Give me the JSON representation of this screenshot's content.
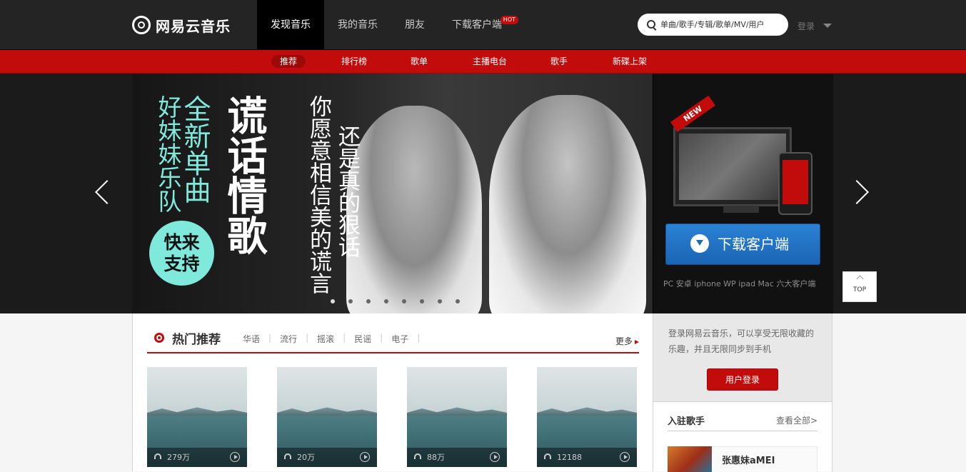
{
  "brand": {
    "name": "网易云音乐"
  },
  "topnav": [
    {
      "label": "发现音乐"
    },
    {
      "label": "我的音乐"
    },
    {
      "label": "朋友"
    },
    {
      "label": "下载客户端",
      "badge": "HOT"
    }
  ],
  "search": {
    "placeholder": "单曲/歌手/专辑/歌单/MV/用户"
  },
  "login": {
    "label": "登录"
  },
  "subnav": [
    "推荐",
    "排行榜",
    "歌单",
    "主播电台",
    "歌手",
    "新碟上架"
  ],
  "banner": {
    "line1": "好妹妹乐队",
    "line2": "全新单曲",
    "badge_line1": "快来",
    "badge_line2": "支持",
    "title": "谎话情歌",
    "tag_line1": "你愿意相信美的谎言",
    "tag_line2": "还是真的狠话",
    "dots_total": 8,
    "dots_active": 0
  },
  "download": {
    "new_tag": "NEW",
    "button_label": "下载客户端",
    "platforms": "PC 安卓 iphone WP ipad Mac 六大客户端"
  },
  "top_button": {
    "label": "TOP"
  },
  "hot": {
    "title": "热门推荐",
    "tabs": [
      "华语",
      "流行",
      "摇滚",
      "民谣",
      "电子"
    ],
    "more": "更多",
    "cards": [
      {
        "count": "279万"
      },
      {
        "count": "20万"
      },
      {
        "count": "88万"
      },
      {
        "count": "12188"
      }
    ]
  },
  "sidebar": {
    "login_tip": "登录网易云音乐，可以享受无限收藏的乐趣，并且无限同步到手机",
    "login_button": "用户登录",
    "singers_title": "入驻歌手",
    "singers_all": "查看全部>",
    "singers": [
      {
        "name": "张惠妹aMEI"
      }
    ]
  },
  "colors": {
    "brand_red": "#c20c0c",
    "topbar_bg": "#242424",
    "banner_accent": "#7fe9dc",
    "download_blue": "#2b82d4"
  }
}
